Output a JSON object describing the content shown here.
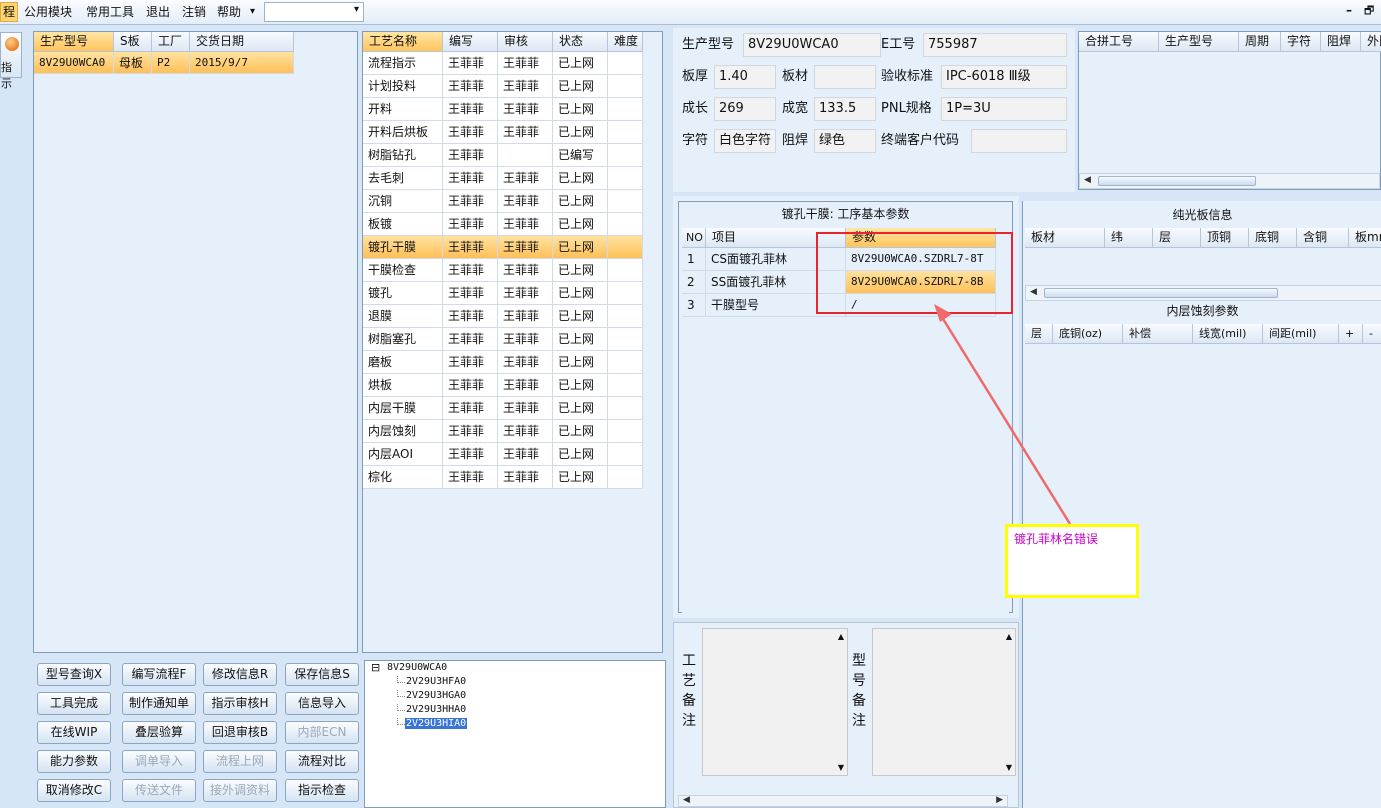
{
  "menu": {
    "items": [
      "程",
      "公用模块",
      "常用工具",
      "退出",
      "注销",
      "帮助"
    ],
    "dropdown_glyph": "▾",
    "combo_value": ""
  },
  "window_controls": {
    "minimize": "–",
    "restore": "🗗"
  },
  "left_tool": {
    "label": "指示"
  },
  "orders_table": {
    "columns": [
      "生产型号",
      "S板",
      "工厂",
      "交货日期"
    ],
    "rows": [
      [
        "8V29U0WCA0",
        "母板",
        "P2",
        "2015/9/7"
      ]
    ]
  },
  "process_table": {
    "columns": [
      "工艺名称",
      "编写",
      "审核",
      "状态",
      "难度"
    ],
    "rows": [
      [
        "流程指示",
        "王菲菲",
        "王菲菲",
        "已上网",
        ""
      ],
      [
        "计划投料",
        "王菲菲",
        "王菲菲",
        "已上网",
        ""
      ],
      [
        "开料",
        "王菲菲",
        "王菲菲",
        "已上网",
        ""
      ],
      [
        "开料后烘板",
        "王菲菲",
        "王菲菲",
        "已上网",
        ""
      ],
      [
        "树脂钻孔",
        "王菲菲",
        "",
        "已编写",
        ""
      ],
      [
        "去毛刺",
        "王菲菲",
        "王菲菲",
        "已上网",
        ""
      ],
      [
        "沉铜",
        "王菲菲",
        "王菲菲",
        "已上网",
        ""
      ],
      [
        "板镀",
        "王菲菲",
        "王菲菲",
        "已上网",
        ""
      ],
      [
        "镀孔干膜",
        "王菲菲",
        "王菲菲",
        "已上网",
        ""
      ],
      [
        "干膜检查",
        "王菲菲",
        "王菲菲",
        "已上网",
        ""
      ],
      [
        "镀孔",
        "王菲菲",
        "王菲菲",
        "已上网",
        ""
      ],
      [
        "退膜",
        "王菲菲",
        "王菲菲",
        "已上网",
        ""
      ],
      [
        "树脂塞孔",
        "王菲菲",
        "王菲菲",
        "已上网",
        ""
      ],
      [
        "磨板",
        "王菲菲",
        "王菲菲",
        "已上网",
        ""
      ],
      [
        "烘板",
        "王菲菲",
        "王菲菲",
        "已上网",
        ""
      ],
      [
        "内层干膜",
        "王菲菲",
        "王菲菲",
        "已上网",
        ""
      ],
      [
        "内层蚀刻",
        "王菲菲",
        "王菲菲",
        "已上网",
        ""
      ],
      [
        "内层AOI",
        "王菲菲",
        "王菲菲",
        "已上网",
        ""
      ],
      [
        "棕化",
        "王菲菲",
        "王菲菲",
        "已上网",
        ""
      ]
    ],
    "selected_row": 8
  },
  "buttons": [
    [
      "型号查询X",
      "编写流程F",
      "修改信息R",
      "保存信息S"
    ],
    [
      "工具完成",
      "制作通知单",
      "指示审核H",
      "信息导入"
    ],
    [
      "在线WIP",
      "叠层验算",
      "回退审核B",
      "内部ECN"
    ],
    [
      "能力参数",
      "调单导入",
      "流程上网",
      "流程对比"
    ],
    [
      "取消修改C",
      "传送文件",
      "接外调资料",
      "指示检查"
    ]
  ],
  "disabled_buttons": [
    "内部ECN",
    "调单导入",
    "流程上网",
    "传送文件",
    "接外调资料"
  ],
  "tree": {
    "root": "8V29U0WCA0",
    "children": [
      "2V29U3HFA0",
      "2V29U3HGA0",
      "2V29U3HHA0",
      "2V29U3HIA0"
    ],
    "selected": 3,
    "collapse_glyph": "⊟"
  },
  "info": {
    "model_label": "生产型号",
    "model_value": "8V29U0WCA0",
    "eno_label": "E工号",
    "eno_value": "755987",
    "thick_label": "板厚",
    "thick_value": "1.40",
    "material_label": "板材",
    "material_value": "",
    "std_label": "验收标准",
    "std_value": "IPC-6018 Ⅲ级",
    "len_label": "成长",
    "len_value": "269",
    "width_label": "成宽",
    "width_value": "133.5",
    "pnl_label": "PNL规格",
    "pnl_value": "1P=3U",
    "char_label": "字符",
    "char_value": "白色字符",
    "mask_label": "阻焊",
    "mask_value": "绿色",
    "cust_label": "终端客户代码",
    "cust_value": ""
  },
  "combine_table": {
    "columns": [
      "合拼工号",
      "生产型号",
      "周期",
      "字符",
      "阻焊",
      "外队"
    ]
  },
  "params": {
    "title": "镀孔干膜: 工序基本参数",
    "columns": [
      "NO",
      "项目",
      "参数"
    ],
    "rows": [
      [
        "1",
        "CS面镀孔菲林",
        "8V29U0WCA0.SZDRL7-8T"
      ],
      [
        "2",
        "SS面镀孔菲林",
        "8V29U0WCA0.SZDRL7-8B"
      ],
      [
        "3",
        "干膜型号",
        "/"
      ]
    ],
    "highlight_row": 1
  },
  "pure_board": {
    "title": "纯光板信息",
    "columns": [
      "板材",
      "纬",
      "层",
      "顶铜",
      "底铜",
      "含铜",
      "板mm"
    ]
  },
  "inner_etch": {
    "title": "内层蚀刻参数",
    "columns": [
      "层",
      "底铜(oz)",
      "补偿",
      "线宽(mil)",
      "间距(mil)",
      "+",
      "-"
    ]
  },
  "annotation": {
    "text": "镀孔菲林名错误",
    "border_color": "#ffff00",
    "text_color": "#cc00cc",
    "arrow_color": "#f06a6a"
  },
  "remarks": {
    "process": "工艺备注",
    "model": "型号备注"
  },
  "colors": {
    "highlight": "#ffc45c",
    "red_box": "#e8242c"
  }
}
